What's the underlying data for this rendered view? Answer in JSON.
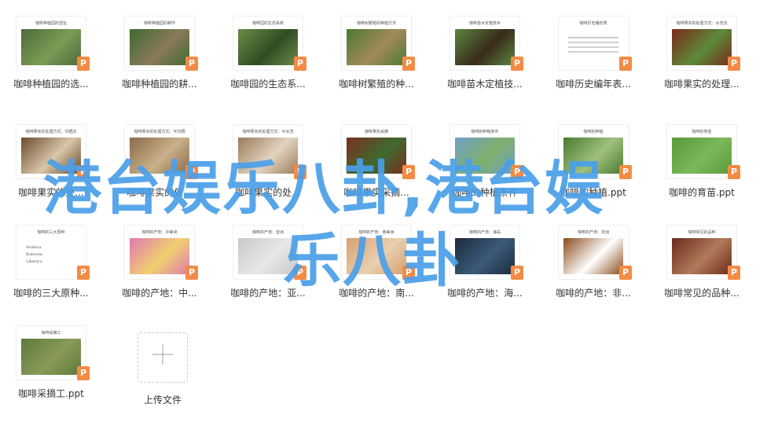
{
  "files": [
    {
      "name": "咖啡种植园的选...",
      "thumb_title": "咖啡种植园的选址",
      "pic": "#4f6a3a",
      "pic2": "#7a9b55"
    },
    {
      "name": "咖啡种植园的耕...",
      "thumb_title": "咖啡种植园的耕作",
      "pic": "#3e6b2f",
      "pic2": "#8a7a5a"
    },
    {
      "name": "咖啡园的生态系...",
      "thumb_title": "咖啡园的生态系统",
      "pic": "#6b8c4a",
      "pic2": "#2f4d22"
    },
    {
      "name": "咖啡树繁殖的种...",
      "thumb_title": "咖啡树繁殖的种植方法",
      "pic": "#4b7a32",
      "pic2": "#a38a5c"
    },
    {
      "name": "咖啡苗木定植技...",
      "thumb_title": "咖啡苗木定植技术",
      "pic": "#5a8740",
      "pic2": "#3a2a1a"
    },
    {
      "name": "咖啡历史编年表...",
      "thumb_title": "咖啡历史编年表",
      "pic": "",
      "pic2": ""
    },
    {
      "name": "咖啡果实的处理...",
      "thumb_title": "咖啡果实的处理方式：水洗法",
      "pic": "#7a2a1a",
      "pic2": "#5c8a3a"
    },
    {
      "name": "咖啡果实的处...",
      "thumb_title": "咖啡果实的处理方式：日晒法",
      "pic": "#6b4a2e",
      "pic2": "#d9c6a8"
    },
    {
      "name": "咖啡果实的处...",
      "thumb_title": "咖啡果实的处理方式：半日晒",
      "pic": "#8a6a4a",
      "pic2": "#c9b08a"
    },
    {
      "name": "咖啡果实的处...",
      "thumb_title": "咖啡果实的处理方式：半水洗",
      "pic": "#9a7a5a",
      "pic2": "#e2d4c0"
    },
    {
      "name": "咖啡果实采摘...",
      "thumb_title": "咖啡果实采摘",
      "pic": "#7a2e1e",
      "pic2": "#3e6b2f"
    },
    {
      "name": "咖啡的种植条件",
      "thumb_title": "咖啡的种植条件",
      "pic": "#6fa0c8",
      "pic2": "#7fb06a"
    },
    {
      "name": "咖啡的种植.ppt",
      "thumb_title": "咖啡的种植",
      "pic": "#4a7a2e",
      "pic2": "#a0c080"
    },
    {
      "name": "咖啡的育苗.ppt",
      "thumb_title": "咖啡的育苗",
      "pic": "#5a9a3a",
      "pic2": "#7ab85a"
    },
    {
      "name": "咖啡的三大原种...",
      "thumb_title": "咖啡的三大原种",
      "pic": "",
      "pic2": ""
    },
    {
      "name": "咖啡的产地：中...",
      "thumb_title": "咖啡的产地：中美洲",
      "pic": "#e07ab0",
      "pic2": "#f0d070"
    },
    {
      "name": "咖啡的产地：亚...",
      "thumb_title": "咖啡的产地：亚洲",
      "pic": "#c8c8c8",
      "pic2": "#e8e8e8"
    },
    {
      "name": "咖啡的产地：南...",
      "thumb_title": "咖啡的产地：南美洲",
      "pic": "#d8a070",
      "pic2": "#e8d0b0"
    },
    {
      "name": "咖啡的产地：海...",
      "thumb_title": "咖啡的产地：海岛",
      "pic": "#1f2a3a",
      "pic2": "#3a5a7a"
    },
    {
      "name": "咖啡的产地：非...",
      "thumb_title": "咖啡的产地：非洲",
      "pic": "#8a4a1a",
      "pic2": "#ffffff"
    },
    {
      "name": "咖啡常见的品种...",
      "thumb_title": "咖啡常见的品种",
      "pic": "#6a2a1a",
      "pic2": "#b07a5a"
    },
    {
      "name": "咖啡采摘工.ppt",
      "thumb_title": "咖啡采摘工",
      "pic": "#5a7a3a",
      "pic2": "#8a9a5a"
    }
  ],
  "doc_thumb_text": {
    "three_species": [
      "Arabica",
      "Robusta",
      "Liberica"
    ]
  },
  "upload": {
    "label": "上传文件",
    "icon": "plus-icon"
  },
  "watermark": {
    "line1": "港台娱乐八卦,港台娱",
    "line2": "乐八卦",
    "color": "#4a9ee8"
  },
  "badge_color": "#f48b45",
  "badge_letter": "P"
}
